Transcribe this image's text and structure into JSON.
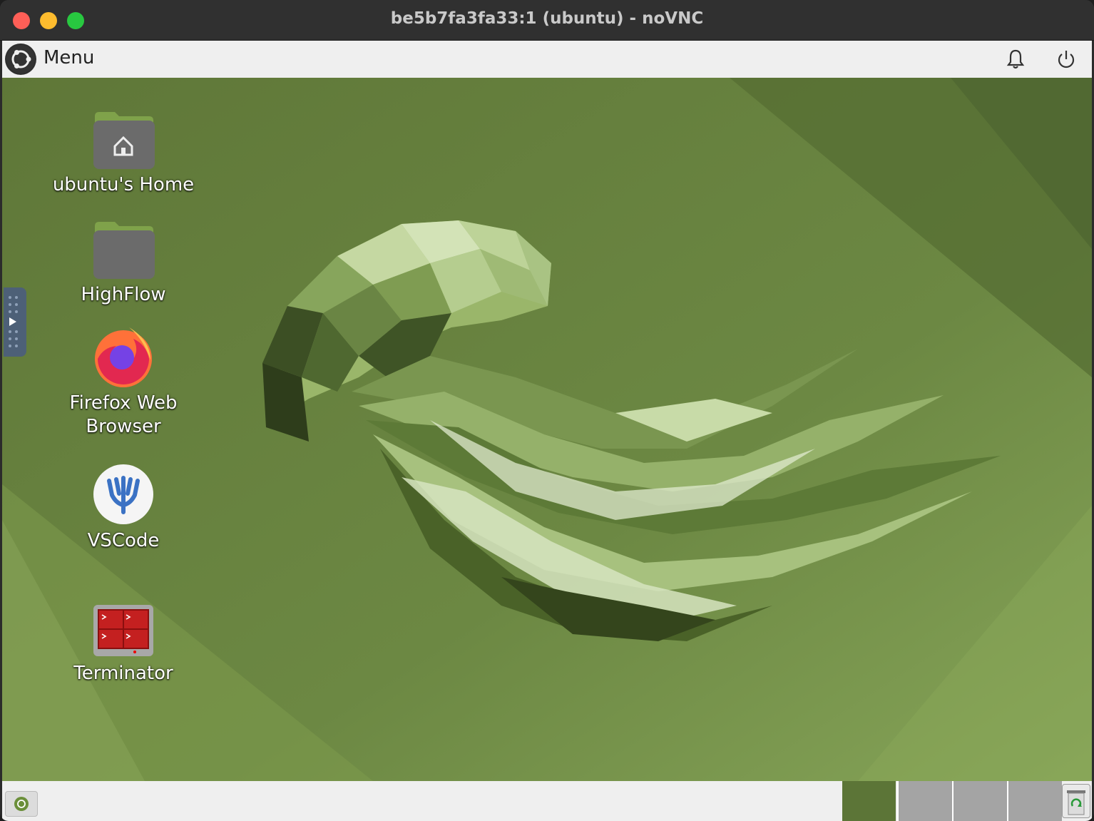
{
  "window": {
    "title": "be5b7fa3fa33:1 (ubuntu) - noVNC",
    "traffic_lights": [
      "close",
      "minimize",
      "maximize"
    ],
    "colors": {
      "close": "#fe5f57",
      "minimize": "#febc2e",
      "maximize": "#28c840"
    }
  },
  "topbar": {
    "menu_icon": "ubuntu-logo-icon",
    "menu_label": "Menu",
    "notification_icon": "bell-icon",
    "power_icon": "power-icon"
  },
  "desktop": {
    "wallpaper": "jellyfish-lowpoly-green",
    "background_color": "#657f3c",
    "icons": [
      {
        "label": "ubuntu's Home",
        "icon": "home-folder-icon"
      },
      {
        "label": "HighFlow",
        "icon": "folder-icon"
      },
      {
        "label": "Firefox Web Browser",
        "icon": "firefox-icon"
      },
      {
        "label": "VSCode",
        "icon": "vscode-icon"
      },
      {
        "label": "Terminator",
        "icon": "terminator-icon"
      }
    ]
  },
  "side_panel": {
    "icon": "expand-arrow-icon"
  },
  "bottombar": {
    "start_icon": "ubuntu-small-icon",
    "workspaces": [
      {
        "active": true
      },
      {
        "active": false
      },
      {
        "active": false
      },
      {
        "active": false
      }
    ],
    "trash_icon": "trash-icon"
  }
}
